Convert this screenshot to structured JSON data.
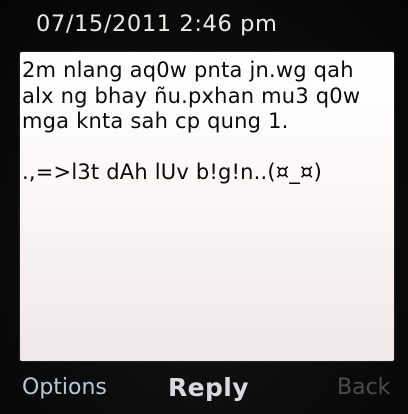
{
  "status": {
    "datetime": "07/15/2011  2:46 pm"
  },
  "message": {
    "body": "2m nlang aq0w pnta jn.wg qah alx ng bhay ñu.pxhan mu3 q0w mga knta sah cp qung 1.\n\n.,=>l3t dAh lUv b!g!n..(¤_¤)"
  },
  "softkeys": {
    "left_label": "Options",
    "center_label": "Reply",
    "right_label": "Back"
  }
}
